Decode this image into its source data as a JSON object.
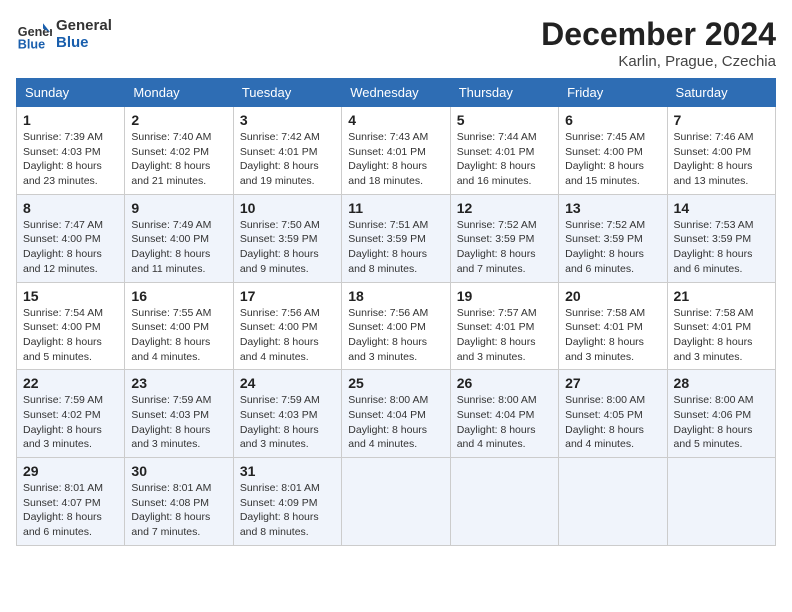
{
  "header": {
    "logo_general": "General",
    "logo_blue": "Blue",
    "month_title": "December 2024",
    "subtitle": "Karlin, Prague, Czechia"
  },
  "weekdays": [
    "Sunday",
    "Monday",
    "Tuesday",
    "Wednesday",
    "Thursday",
    "Friday",
    "Saturday"
  ],
  "weeks": [
    [
      {
        "day": "1",
        "sunrise": "Sunrise: 7:39 AM",
        "sunset": "Sunset: 4:03 PM",
        "daylight": "Daylight: 8 hours and 23 minutes."
      },
      {
        "day": "2",
        "sunrise": "Sunrise: 7:40 AM",
        "sunset": "Sunset: 4:02 PM",
        "daylight": "Daylight: 8 hours and 21 minutes."
      },
      {
        "day": "3",
        "sunrise": "Sunrise: 7:42 AM",
        "sunset": "Sunset: 4:01 PM",
        "daylight": "Daylight: 8 hours and 19 minutes."
      },
      {
        "day": "4",
        "sunrise": "Sunrise: 7:43 AM",
        "sunset": "Sunset: 4:01 PM",
        "daylight": "Daylight: 8 hours and 18 minutes."
      },
      {
        "day": "5",
        "sunrise": "Sunrise: 7:44 AM",
        "sunset": "Sunset: 4:01 PM",
        "daylight": "Daylight: 8 hours and 16 minutes."
      },
      {
        "day": "6",
        "sunrise": "Sunrise: 7:45 AM",
        "sunset": "Sunset: 4:00 PM",
        "daylight": "Daylight: 8 hours and 15 minutes."
      },
      {
        "day": "7",
        "sunrise": "Sunrise: 7:46 AM",
        "sunset": "Sunset: 4:00 PM",
        "daylight": "Daylight: 8 hours and 13 minutes."
      }
    ],
    [
      {
        "day": "8",
        "sunrise": "Sunrise: 7:47 AM",
        "sunset": "Sunset: 4:00 PM",
        "daylight": "Daylight: 8 hours and 12 minutes."
      },
      {
        "day": "9",
        "sunrise": "Sunrise: 7:49 AM",
        "sunset": "Sunset: 4:00 PM",
        "daylight": "Daylight: 8 hours and 11 minutes."
      },
      {
        "day": "10",
        "sunrise": "Sunrise: 7:50 AM",
        "sunset": "Sunset: 3:59 PM",
        "daylight": "Daylight: 8 hours and 9 minutes."
      },
      {
        "day": "11",
        "sunrise": "Sunrise: 7:51 AM",
        "sunset": "Sunset: 3:59 PM",
        "daylight": "Daylight: 8 hours and 8 minutes."
      },
      {
        "day": "12",
        "sunrise": "Sunrise: 7:52 AM",
        "sunset": "Sunset: 3:59 PM",
        "daylight": "Daylight: 8 hours and 7 minutes."
      },
      {
        "day": "13",
        "sunrise": "Sunrise: 7:52 AM",
        "sunset": "Sunset: 3:59 PM",
        "daylight": "Daylight: 8 hours and 6 minutes."
      },
      {
        "day": "14",
        "sunrise": "Sunrise: 7:53 AM",
        "sunset": "Sunset: 3:59 PM",
        "daylight": "Daylight: 8 hours and 6 minutes."
      }
    ],
    [
      {
        "day": "15",
        "sunrise": "Sunrise: 7:54 AM",
        "sunset": "Sunset: 4:00 PM",
        "daylight": "Daylight: 8 hours and 5 minutes."
      },
      {
        "day": "16",
        "sunrise": "Sunrise: 7:55 AM",
        "sunset": "Sunset: 4:00 PM",
        "daylight": "Daylight: 8 hours and 4 minutes."
      },
      {
        "day": "17",
        "sunrise": "Sunrise: 7:56 AM",
        "sunset": "Sunset: 4:00 PM",
        "daylight": "Daylight: 8 hours and 4 minutes."
      },
      {
        "day": "18",
        "sunrise": "Sunrise: 7:56 AM",
        "sunset": "Sunset: 4:00 PM",
        "daylight": "Daylight: 8 hours and 3 minutes."
      },
      {
        "day": "19",
        "sunrise": "Sunrise: 7:57 AM",
        "sunset": "Sunset: 4:01 PM",
        "daylight": "Daylight: 8 hours and 3 minutes."
      },
      {
        "day": "20",
        "sunrise": "Sunrise: 7:58 AM",
        "sunset": "Sunset: 4:01 PM",
        "daylight": "Daylight: 8 hours and 3 minutes."
      },
      {
        "day": "21",
        "sunrise": "Sunrise: 7:58 AM",
        "sunset": "Sunset: 4:01 PM",
        "daylight": "Daylight: 8 hours and 3 minutes."
      }
    ],
    [
      {
        "day": "22",
        "sunrise": "Sunrise: 7:59 AM",
        "sunset": "Sunset: 4:02 PM",
        "daylight": "Daylight: 8 hours and 3 minutes."
      },
      {
        "day": "23",
        "sunrise": "Sunrise: 7:59 AM",
        "sunset": "Sunset: 4:03 PM",
        "daylight": "Daylight: 8 hours and 3 minutes."
      },
      {
        "day": "24",
        "sunrise": "Sunrise: 7:59 AM",
        "sunset": "Sunset: 4:03 PM",
        "daylight": "Daylight: 8 hours and 3 minutes."
      },
      {
        "day": "25",
        "sunrise": "Sunrise: 8:00 AM",
        "sunset": "Sunset: 4:04 PM",
        "daylight": "Daylight: 8 hours and 4 minutes."
      },
      {
        "day": "26",
        "sunrise": "Sunrise: 8:00 AM",
        "sunset": "Sunset: 4:04 PM",
        "daylight": "Daylight: 8 hours and 4 minutes."
      },
      {
        "day": "27",
        "sunrise": "Sunrise: 8:00 AM",
        "sunset": "Sunset: 4:05 PM",
        "daylight": "Daylight: 8 hours and 4 minutes."
      },
      {
        "day": "28",
        "sunrise": "Sunrise: 8:00 AM",
        "sunset": "Sunset: 4:06 PM",
        "daylight": "Daylight: 8 hours and 5 minutes."
      }
    ],
    [
      {
        "day": "29",
        "sunrise": "Sunrise: 8:01 AM",
        "sunset": "Sunset: 4:07 PM",
        "daylight": "Daylight: 8 hours and 6 minutes."
      },
      {
        "day": "30",
        "sunrise": "Sunrise: 8:01 AM",
        "sunset": "Sunset: 4:08 PM",
        "daylight": "Daylight: 8 hours and 7 minutes."
      },
      {
        "day": "31",
        "sunrise": "Sunrise: 8:01 AM",
        "sunset": "Sunset: 4:09 PM",
        "daylight": "Daylight: 8 hours and 8 minutes."
      },
      null,
      null,
      null,
      null
    ]
  ]
}
